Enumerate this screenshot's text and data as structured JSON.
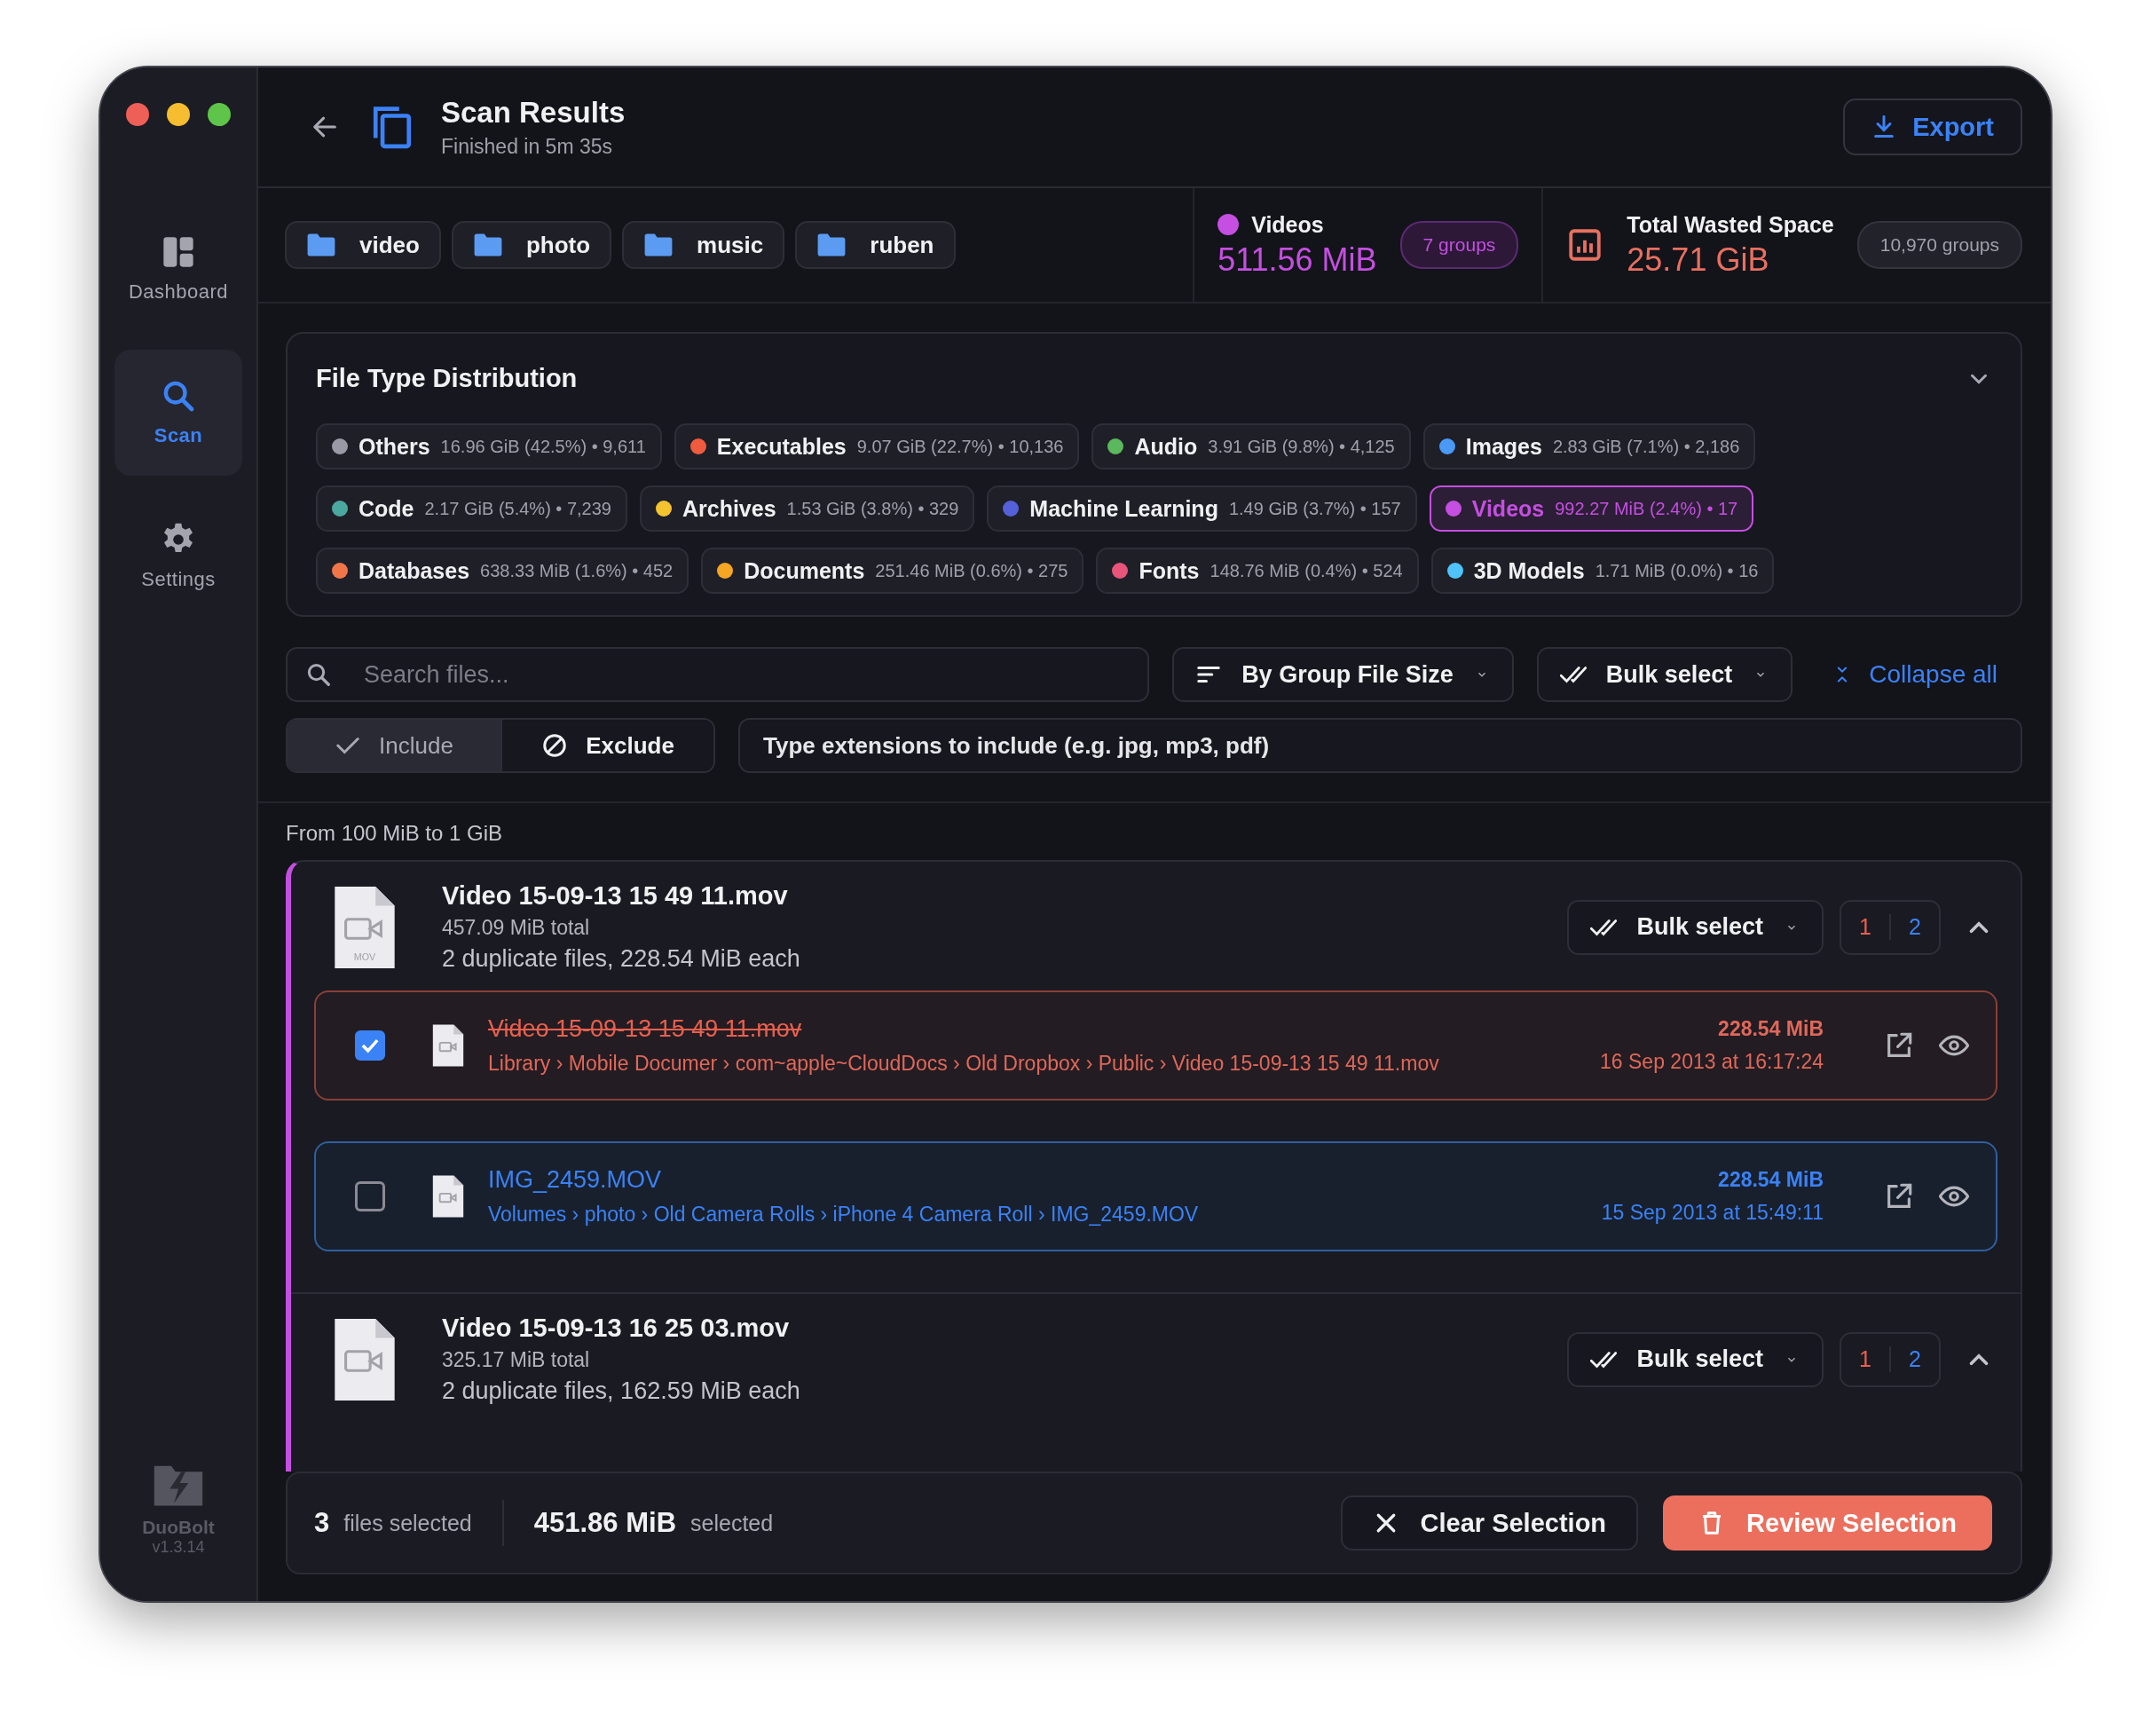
{
  "window": {
    "title": "Scan Results",
    "subtitle": "Finished in 5m 35s"
  },
  "sidebar": {
    "items": [
      {
        "label": "Dashboard",
        "kind": "dashboard",
        "selected": false
      },
      {
        "label": "Scan",
        "kind": "scan",
        "selected": true
      },
      {
        "label": "Settings",
        "kind": "settings",
        "selected": false
      }
    ],
    "app_name": "DuoBolt",
    "version": "v1.3.14"
  },
  "export_button": "Export",
  "folders": [
    "video",
    "photo",
    "music",
    "ruben"
  ],
  "selected_type": {
    "label": "Videos",
    "color": "#c44fe0",
    "size": "511.56 MiB",
    "badge": "7 groups"
  },
  "total": {
    "label": "Total Wasted Space",
    "size": "25.71 GiB",
    "badge": "10,970 groups"
  },
  "distribution": {
    "title": "File Type Distribution",
    "types": [
      {
        "name": "Others",
        "detail": "16.96 GiB (42.5%) • 9,611",
        "color": "#9a9aa6",
        "selected": false
      },
      {
        "name": "Executables",
        "detail": "9.07 GiB (22.7%) • 10,136",
        "color": "#ef5b3f",
        "selected": false
      },
      {
        "name": "Audio",
        "detail": "3.91 GiB (9.8%) • 4,125",
        "color": "#5cb85c",
        "selected": false
      },
      {
        "name": "Images",
        "detail": "2.83 GiB (7.1%) • 2,186",
        "color": "#4a9af5",
        "selected": false
      },
      {
        "name": "Code",
        "detail": "2.17 GiB (5.4%) • 7,239",
        "color": "#4ba8a0",
        "selected": false
      },
      {
        "name": "Archives",
        "detail": "1.53 GiB (3.8%) • 329",
        "color": "#f4c430",
        "selected": false
      },
      {
        "name": "Machine Learning",
        "detail": "1.49 GiB (3.7%) • 157",
        "color": "#5561d8",
        "selected": false
      },
      {
        "name": "Videos",
        "detail": "992.27 MiB (2.4%) • 17",
        "color": "#c44fe0",
        "selected": true
      },
      {
        "name": "Databases",
        "detail": "638.33 MiB (1.6%) • 452",
        "color": "#f0764a",
        "selected": false
      },
      {
        "name": "Documents",
        "detail": "251.46 MiB (0.6%) • 275",
        "color": "#f5a623",
        "selected": false
      },
      {
        "name": "Fonts",
        "detail": "148.76 MiB (0.4%) • 524",
        "color": "#e8547a",
        "selected": false
      },
      {
        "name": "3D Models",
        "detail": "1.71 MiB (0.0%) • 16",
        "color": "#4fc3f7",
        "selected": false
      }
    ]
  },
  "search": {
    "placeholder": "Search files..."
  },
  "sort": "By Group File Size",
  "bulk_select": "Bulk select",
  "collapse": "Collapse all",
  "filter_mode": [
    {
      "label": "Include",
      "kind": "include",
      "selected": true
    },
    {
      "label": "Exclude",
      "kind": "exclude",
      "selected": false
    }
  ],
  "extensions": {
    "placeholder": "Type extensions to include (e.g. jpg, mp3, pdf)"
  },
  "size_range": "From 100 MiB to 1 GiB",
  "groups": [
    {
      "name": "Video 15-09-13 15 49 11.mov",
      "total": "457.09 MiB total",
      "summary": "2 duplicate files, 228.54 MiB each",
      "file_label": "MOV",
      "bulk": "Bulk select",
      "expanded": true,
      "counts": [
        {
          "text": "1",
          "color": "#e8604f"
        },
        {
          "text": "2",
          "color": "#3b82f6"
        }
      ],
      "files": [
        {
          "name": "Video 15-09-13 15 49 11.mov",
          "path": "Library › Mobile Documer › com~apple~CloudDocs › Old Dropbox › Public › Video 15-09-13 15 49 11.mov",
          "size": "228.54 MiB",
          "date": "16 Sep 2013 at 16:17:24",
          "checked": true
        },
        {
          "name": "IMG_2459.MOV",
          "path": "Volumes › photo › Old Camera Rolls › iPhone 4 Camera Roll › IMG_2459.MOV",
          "size": "228.54 MiB",
          "date": "15 Sep 2013 at 15:49:11",
          "checked": false
        }
      ]
    },
    {
      "name": "Video 15-09-13 16 25 03.mov",
      "total": "325.17 MiB total",
      "summary": "2 duplicate files, 162.59 MiB each",
      "bulk": "Bulk select",
      "expanded": true,
      "counts": [
        {
          "text": "1",
          "color": "#e8604f"
        },
        {
          "text": "2",
          "color": "#3b82f6"
        }
      ]
    }
  ],
  "selection": {
    "count": "3",
    "count_label": "files selected",
    "size": "451.86 MiB",
    "size_label": "selected"
  },
  "clear_button": "Clear Selection",
  "review_button": "Review Selection"
}
